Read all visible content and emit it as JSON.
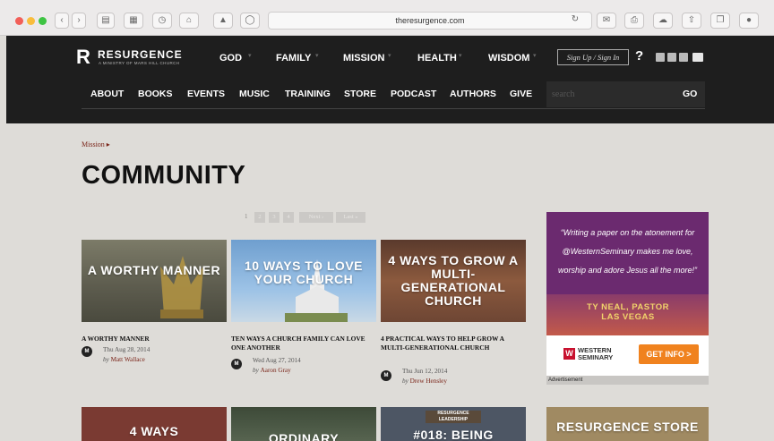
{
  "browser": {
    "url": "theresurgence.com",
    "nav_icons": [
      "back-icon",
      "forward-icon",
      "sidebar-icon",
      "grid-icon",
      "history-icon",
      "home-icon",
      "pin-icon",
      "screenshot-icon"
    ],
    "right_icons": [
      "reload-icon",
      "mail-icon",
      "print-icon",
      "cloud-icon",
      "share-icon",
      "tabs-icon",
      "extension-icon"
    ]
  },
  "site": {
    "logo_mark": "R",
    "logo_name": "RESURGENCE",
    "logo_tagline": "A MINISTRY OF MARS HILL CHURCH",
    "top_nav": [
      "GOD",
      "FAMILY",
      "MISSION",
      "HEALTH",
      "WISDOM"
    ],
    "signin_label": "Sign Up / Sign In",
    "help_label": "?",
    "social_icons": [
      "facebook-icon",
      "twitter-icon",
      "rss-icon",
      "email-icon"
    ],
    "sub_nav": [
      "ABOUT",
      "BOOKS",
      "EVENTS",
      "MUSIC",
      "TRAINING",
      "STORE",
      "PODCAST",
      "AUTHORS",
      "GIVE"
    ],
    "search_placeholder": "search",
    "search_go": "GO"
  },
  "page": {
    "breadcrumb": "Mission ▸",
    "title": "COMMUNITY",
    "pagination": [
      "1",
      "2",
      "3",
      "4",
      "Next ›",
      "Last »"
    ]
  },
  "articles": [
    {
      "image_text": "A WORTHY MANNER",
      "title": "A WORTHY MANNER",
      "date": "Thu Aug 28, 2014",
      "by": "by",
      "author": "Matt Wallace"
    },
    {
      "image_text": "10 WAYS TO LOVE YOUR CHURCH",
      "title": "TEN WAYS A CHURCH FAMILY CAN LOVE ONE ANOTHER",
      "date": "Wed Aug 27, 2014",
      "by": "by",
      "author": "Aaron Gray"
    },
    {
      "image_text": "4 WAYS TO GROW A MULTI-GENERATIONAL CHURCH",
      "title": "4 PRACTICAL WAYS TO HELP GROW A MULTI-GENERATIONAL CHURCH",
      "date": "Thu Jun 12, 2014",
      "by": "by",
      "author": "Drew Hensley"
    }
  ],
  "next_row": {
    "card1_text": "4 WAYS",
    "card2_text": "ORDINARY",
    "card3_badge": "RESURGENCE LEADERSHIP",
    "card3_text": "#018: BEING",
    "card4_text": "RESURGENCE STORE"
  },
  "ad": {
    "quote": "“Writing a paper on the atonement for @WesternSeminary makes me love, worship and adore Jesus all the more!”",
    "signature": "TY NEAL, PASTOR LAS VEGAS",
    "brand": "WESTERN SEMINARY",
    "brand_mark": "W",
    "cta": "GET INFO >",
    "label": "Advertisement"
  },
  "mars_hill_mark": "M"
}
